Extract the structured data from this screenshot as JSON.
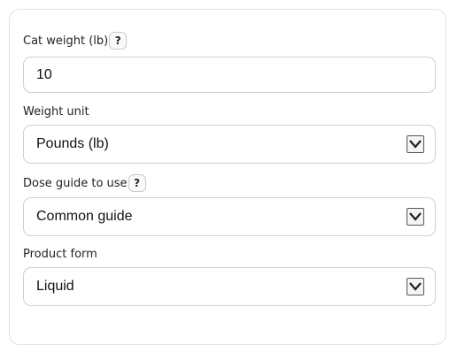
{
  "fields": [
    {
      "label": "Cat weight (lb)",
      "has_help": true,
      "type": "input",
      "value": "10"
    },
    {
      "label": "Weight unit",
      "has_help": false,
      "type": "select",
      "value": "Pounds (lb)"
    },
    {
      "label": "Dose guide to use",
      "has_help": true,
      "type": "select",
      "value": "Common guide"
    },
    {
      "label": "Product form",
      "has_help": false,
      "type": "select",
      "value": "Liquid"
    }
  ],
  "help_label": "?",
  "icons": {
    "help": "question-icon",
    "dropdown": "chevron-down-icon"
  }
}
